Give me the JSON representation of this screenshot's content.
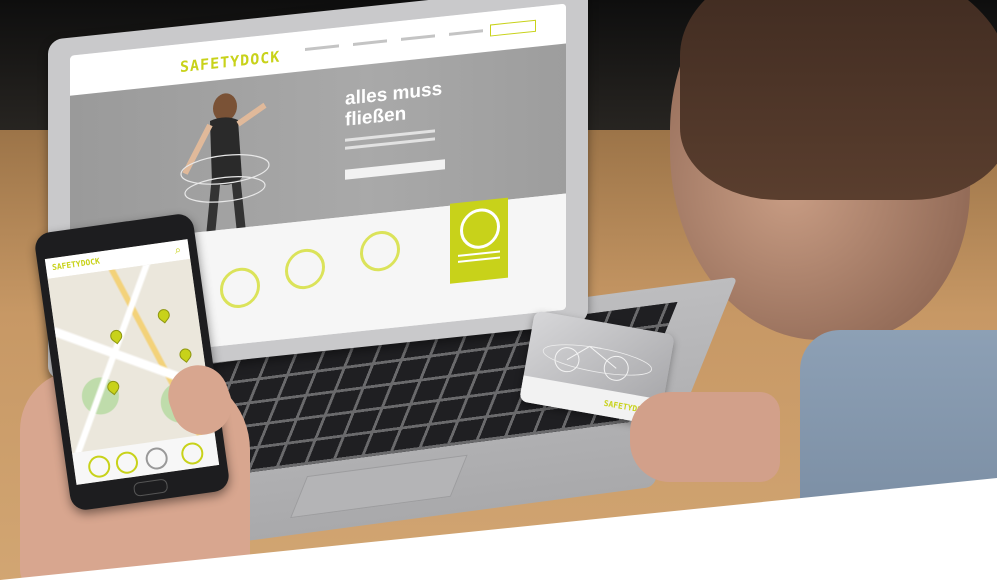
{
  "photo": {
    "subject": "",
    "laptop_site": {
      "logo": "SAFETYDOCK",
      "hero_title_line1": "alles muss",
      "hero_title_line2": "fließen"
    },
    "phone_app": {
      "logo": "SAFETYDOCK"
    },
    "card": {
      "logo": "SAFETYDOCK"
    }
  },
  "colors": {
    "brand_green": "#c8d21a",
    "background": "#ffffff"
  }
}
